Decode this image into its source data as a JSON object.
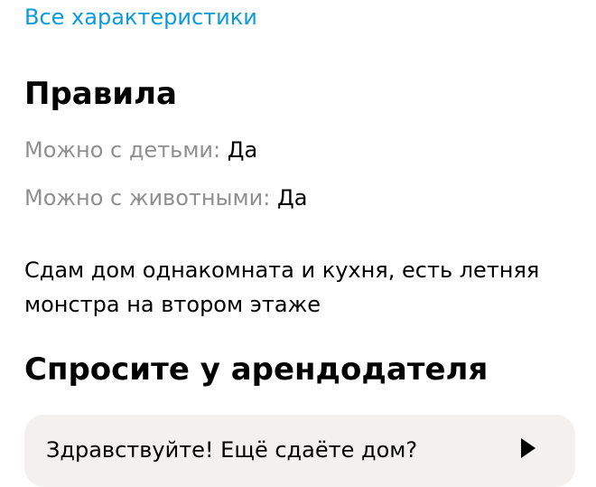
{
  "links": {
    "all_specs": "Все характеристики"
  },
  "rules": {
    "title": "Правила",
    "items": [
      {
        "label": "Можно с детьми:",
        "value": "Да"
      },
      {
        "label": "Можно с животными:",
        "value": "Да"
      }
    ]
  },
  "description": "Сдам дом однакомната и кухня, есть летняя монстра на втором этаже",
  "ask_landlord": {
    "title": "Спросите у арендодателя",
    "question_preview": "Здравствуйте! Ещё сдаёте дом?",
    "send_icon": "send-arrow-icon"
  },
  "colors": {
    "link": "#0a9bd9",
    "label_gray": "#8f8f8f",
    "question_bg": "#f2f1f0"
  }
}
